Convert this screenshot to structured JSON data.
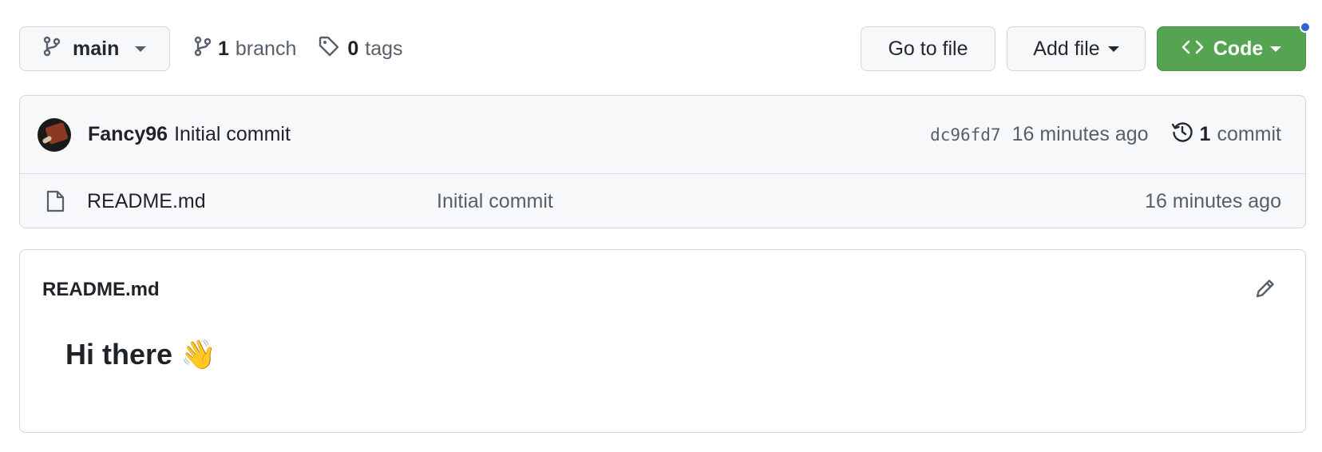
{
  "toolbar": {
    "branch_name": "main",
    "branch_count": "1",
    "branch_label": "branch",
    "tag_count": "0",
    "tag_label": "tags",
    "go_to_file": "Go to file",
    "add_file": "Add file",
    "code": "Code",
    "code_color": "#55a452",
    "notification_dot_color": "#2f63d8"
  },
  "commit": {
    "author": "Fancy96",
    "message": "Initial commit",
    "sha": "dc96fd7",
    "time": "16 minutes ago",
    "count": "1",
    "count_label": "commit"
  },
  "files": [
    {
      "name": "README.md",
      "message": "Initial commit",
      "time": "16 minutes ago",
      "icon": "file-icon"
    }
  ],
  "readme": {
    "title": "README.md",
    "heading": "Hi there 👋"
  }
}
